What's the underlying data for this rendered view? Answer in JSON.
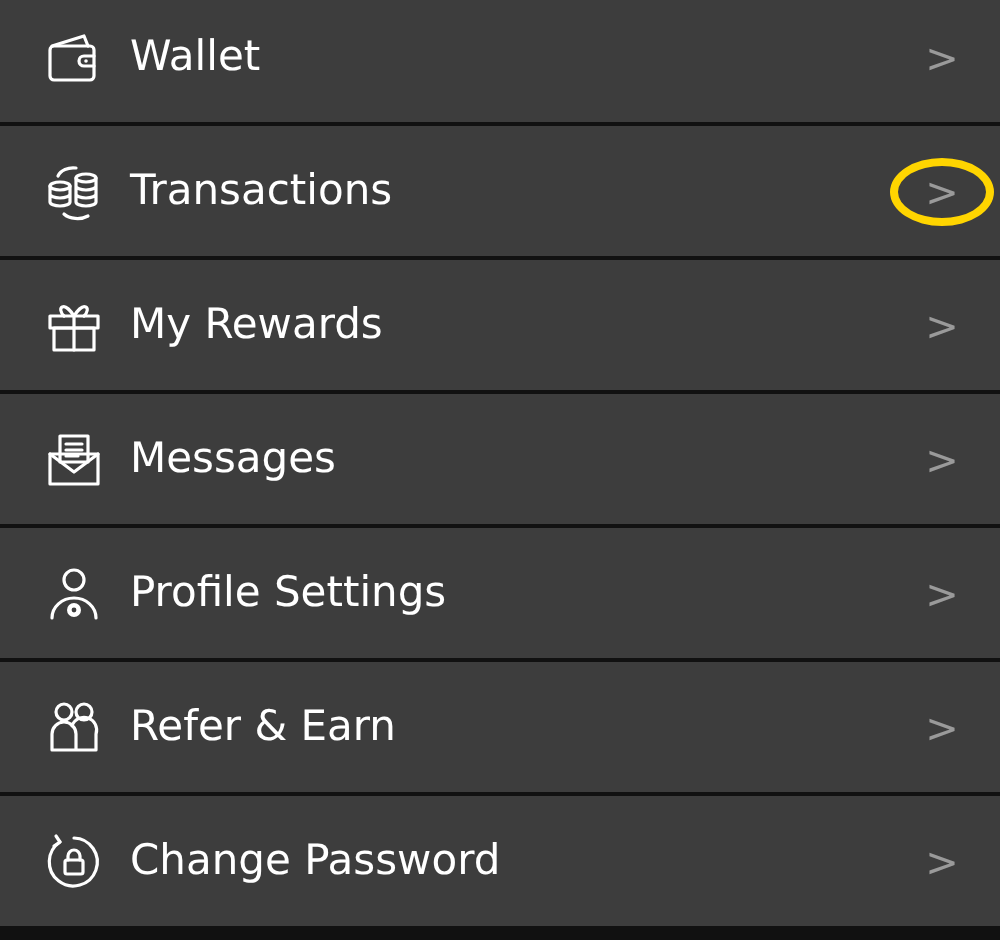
{
  "menu": [
    {
      "label": "Wallet",
      "chevron": ">",
      "highlighted": false
    },
    {
      "label": "Transactions",
      "chevron": ">",
      "highlighted": true
    },
    {
      "label": "My Rewards",
      "chevron": ">",
      "highlighted": false
    },
    {
      "label": "Messages",
      "chevron": ">",
      "highlighted": false
    },
    {
      "label": "Profile Settings",
      "chevron": ">",
      "highlighted": false
    },
    {
      "label": "Refer & Earn",
      "chevron": ">",
      "highlighted": false
    },
    {
      "label": "Change Password",
      "chevron": ">",
      "highlighted": false
    }
  ]
}
